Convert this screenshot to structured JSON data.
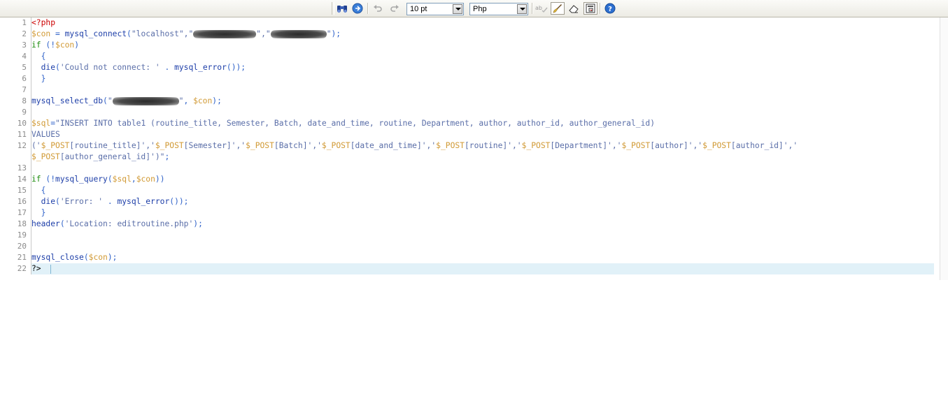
{
  "toolbar": {
    "font_size": "10 pt",
    "language": "Php",
    "icons": [
      "binoculars-icon",
      "globe-icon",
      "undo-icon",
      "redo-icon",
      "spellcheck-icon",
      "brush-icon",
      "eraser-icon",
      "paste-icon",
      "help-icon"
    ]
  },
  "colors": {
    "variable": "#d19a35",
    "function": "#1d3ea8",
    "keyword": "#1a8a0a",
    "string": "#5a6ea8",
    "php_tag": "#cc0000",
    "current_line": "#e1f1f8"
  },
  "line_numbers": [
    "1",
    "2",
    "3",
    "4",
    "5",
    "6",
    "7",
    "8",
    "9",
    "10",
    "11",
    "12",
    "",
    "13",
    "14",
    "15",
    "16",
    "17",
    "18",
    "19",
    "20",
    "21",
    "22"
  ],
  "lines": [
    [
      {
        "t": "<?php",
        "c": "tag"
      }
    ],
    [
      {
        "t": "$con",
        "c": "var"
      },
      {
        "t": " = ",
        "c": "op"
      },
      {
        "t": "mysql_connect",
        "c": "fn"
      },
      {
        "t": "(",
        "c": "paren"
      },
      {
        "t": "\"localhost\",\"",
        "c": "str"
      },
      {
        "r": 90
      },
      {
        "t": "\",\"",
        "c": "str"
      },
      {
        "r": 80
      },
      {
        "t": "\"",
        "c": "str"
      },
      {
        "t": ");",
        "c": "paren"
      }
    ],
    [
      {
        "t": "if",
        "c": "kw"
      },
      {
        "t": " (",
        "c": "paren"
      },
      {
        "t": "!",
        "c": "op"
      },
      {
        "t": "$con",
        "c": "var"
      },
      {
        "t": ")",
        "c": "paren"
      }
    ],
    [
      {
        "t": "  {",
        "c": "paren"
      }
    ],
    [
      {
        "t": "  ",
        "c": "plain"
      },
      {
        "t": "die",
        "c": "fn"
      },
      {
        "t": "(",
        "c": "paren"
      },
      {
        "t": "'Could not connect: '",
        "c": "str"
      },
      {
        "t": " . ",
        "c": "op"
      },
      {
        "t": "mysql_error",
        "c": "fn"
      },
      {
        "t": "());",
        "c": "paren"
      }
    ],
    [
      {
        "t": "  }",
        "c": "paren"
      }
    ],
    [],
    [
      {
        "t": "mysql_select_db",
        "c": "fn"
      },
      {
        "t": "(",
        "c": "paren"
      },
      {
        "t": "\"",
        "c": "str"
      },
      {
        "r": 95
      },
      {
        "t": "\"",
        "c": "str"
      },
      {
        "t": ", ",
        "c": "op"
      },
      {
        "t": "$con",
        "c": "var"
      },
      {
        "t": ");",
        "c": "paren"
      }
    ],
    [],
    [
      {
        "t": "$sql",
        "c": "var"
      },
      {
        "t": "=",
        "c": "op"
      },
      {
        "t": "\"INSERT INTO table1 (routine_title, Semester, Batch, date_and_time, routine, Department, author, author_id, author_general_id)",
        "c": "str"
      }
    ],
    [
      {
        "t": "VALUES",
        "c": "str"
      }
    ],
    [
      {
        "t": "('",
        "c": "str"
      },
      {
        "t": "$_POST",
        "c": "var"
      },
      {
        "t": "[routine_title]','",
        "c": "str"
      },
      {
        "t": "$_POST",
        "c": "var"
      },
      {
        "t": "[Semester]','",
        "c": "str"
      },
      {
        "t": "$_POST",
        "c": "var"
      },
      {
        "t": "[Batch]','",
        "c": "str"
      },
      {
        "t": "$_POST",
        "c": "var"
      },
      {
        "t": "[date_and_time]','",
        "c": "str"
      },
      {
        "t": "$_POST",
        "c": "var"
      },
      {
        "t": "[routine]','",
        "c": "str"
      },
      {
        "t": "$_POST",
        "c": "var"
      },
      {
        "t": "[Department]','",
        "c": "str"
      },
      {
        "t": "$_POST",
        "c": "var"
      },
      {
        "t": "[author]','",
        "c": "str"
      },
      {
        "t": "$_POST",
        "c": "var"
      },
      {
        "t": "[author_id]','",
        "c": "str"
      }
    ],
    [
      {
        "t": "$_POST",
        "c": "var"
      },
      {
        "t": "[author_general_id]')\"",
        "c": "str"
      },
      {
        "t": ";",
        "c": "paren"
      }
    ],
    [],
    [
      {
        "t": "if",
        "c": "kw"
      },
      {
        "t": " (",
        "c": "paren"
      },
      {
        "t": "!",
        "c": "op"
      },
      {
        "t": "mysql_query",
        "c": "fn"
      },
      {
        "t": "(",
        "c": "paren"
      },
      {
        "t": "$sql",
        "c": "var"
      },
      {
        "t": ",",
        "c": "op"
      },
      {
        "t": "$con",
        "c": "var"
      },
      {
        "t": "))",
        "c": "paren"
      }
    ],
    [
      {
        "t": "  {",
        "c": "paren"
      }
    ],
    [
      {
        "t": "  ",
        "c": "plain"
      },
      {
        "t": "die",
        "c": "fn"
      },
      {
        "t": "(",
        "c": "paren"
      },
      {
        "t": "'Error: '",
        "c": "str"
      },
      {
        "t": " . ",
        "c": "op"
      },
      {
        "t": "mysql_error",
        "c": "fn"
      },
      {
        "t": "());",
        "c": "paren"
      }
    ],
    [
      {
        "t": "  }",
        "c": "paren"
      }
    ],
    [
      {
        "t": "header",
        "c": "fn"
      },
      {
        "t": "(",
        "c": "paren"
      },
      {
        "t": "'Location: editroutine.php'",
        "c": "str"
      },
      {
        "t": ");",
        "c": "paren"
      }
    ],
    [],
    [],
    [
      {
        "t": "mysql_close",
        "c": "fn"
      },
      {
        "t": "(",
        "c": "paren"
      },
      {
        "t": "$con",
        "c": "var"
      },
      {
        "t": ");",
        "c": "paren"
      }
    ],
    [
      {
        "t": "?>",
        "c": "plain"
      }
    ]
  ]
}
